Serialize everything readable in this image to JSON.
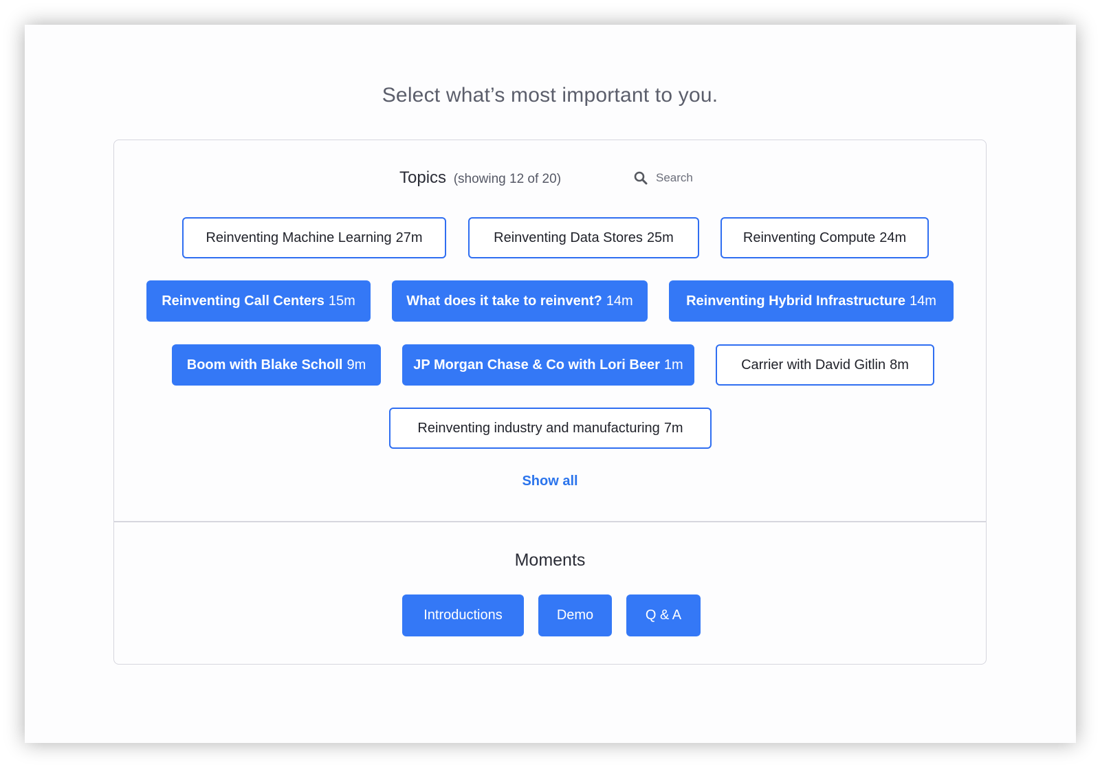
{
  "heading": "Select what’s most important to you.",
  "topics": {
    "title": "Topics",
    "count_label": "(showing 12 of 20)",
    "search_placeholder": "Search",
    "items": [
      {
        "name": "Reinventing Machine Learning",
        "duration": "27m",
        "selected": false
      },
      {
        "name": "Reinventing Data Stores ",
        "duration": "25m",
        "selected": false
      },
      {
        "name": "Reinventing Compute",
        "duration": "24m",
        "selected": false
      },
      {
        "name": "Reinventing Call Centers",
        "duration": "15m",
        "selected": true
      },
      {
        "name": "What does it take to reinvent?",
        "duration": "14m",
        "selected": true
      },
      {
        "name": "Reinventing Hybrid Infrastructure",
        "duration": "14m",
        "selected": true
      },
      {
        "name": "Boom with Blake Scholl",
        "duration": "9m",
        "selected": true
      },
      {
        "name": "JP Morgan Chase & Co with Lori Beer",
        "duration": "1m",
        "selected": true
      },
      {
        "name": "Carrier with David Gitlin",
        "duration": "8m",
        "selected": false
      },
      {
        "name": "Reinventing industry and manufacturing",
        "duration": "7m",
        "selected": false
      }
    ],
    "show_all_label": "Show all"
  },
  "moments": {
    "title": "Moments",
    "items": [
      "Introductions",
      "Demo",
      "Q & A"
    ]
  },
  "colors": {
    "accent": "#3478f6",
    "link": "#2b74ec",
    "outline": "#2f6ef1"
  }
}
